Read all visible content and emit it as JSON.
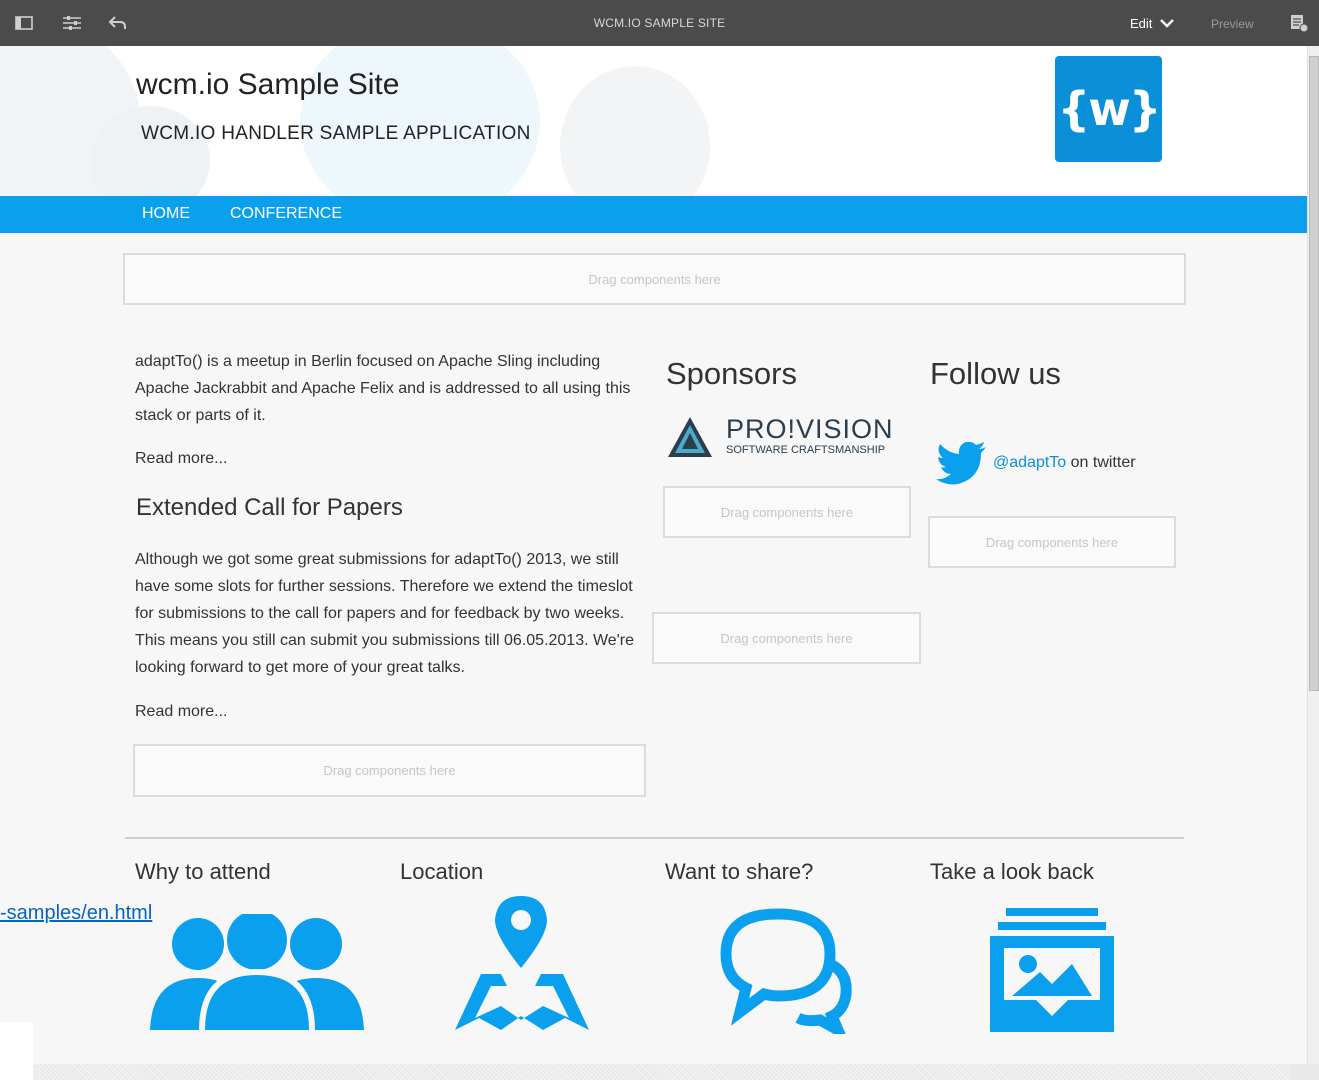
{
  "toolbar": {
    "title": "WCM.IO SAMPLE SITE",
    "edit_label": "Edit",
    "preview_label": "Preview"
  },
  "header": {
    "site_title": "wcm.io Sample Site",
    "site_subtitle": "WCM.IO HANDLER SAMPLE APPLICATION",
    "logo_text": "{w}"
  },
  "nav": {
    "items": [
      {
        "label": "HOME"
      },
      {
        "label": "CONFERENCE"
      }
    ]
  },
  "dropzone_label": "Drag components here",
  "main": {
    "intro_text": "adaptTo() is a meetup in Berlin focused on Apache Sling including Apache Jackrabbit and Apache Felix and is addressed to all using this stack or parts of it.",
    "read_more_1": "Read more...",
    "article_title": "Extended Call for Papers",
    "article_text": "Although we got some great submissions for adaptTo() 2013, we still have some slots for further sessions. Therefore we extend the timeslot for submissions to the call for papers and for feedback by two weeks. This means you still can submit you submissions till 06.05.2013. We're looking forward to get more of your great talks.",
    "read_more_2": "Read more..."
  },
  "sponsors": {
    "title": "Sponsors",
    "logo_name": "PRO!VISION",
    "logo_tagline": "SOFTWARE CRAFTSMANSHIP"
  },
  "follow": {
    "title": "Follow us",
    "handle": "@adaptTo",
    "suffix": " on twitter"
  },
  "footer_teasers": [
    {
      "title": "Why to attend",
      "icon": "people-icon"
    },
    {
      "title": "Location",
      "icon": "map-pin-icon"
    },
    {
      "title": "Want to share?",
      "icon": "chat-bubbles-icon"
    },
    {
      "title": "Take a look back",
      "icon": "photo-archive-icon"
    }
  ],
  "overlay_link": "-samples/en.html",
  "colors": {
    "toolbar_bg": "#4b4b4b",
    "nav_bg": "#0aa0ee",
    "accent": "#0a8fd8"
  }
}
